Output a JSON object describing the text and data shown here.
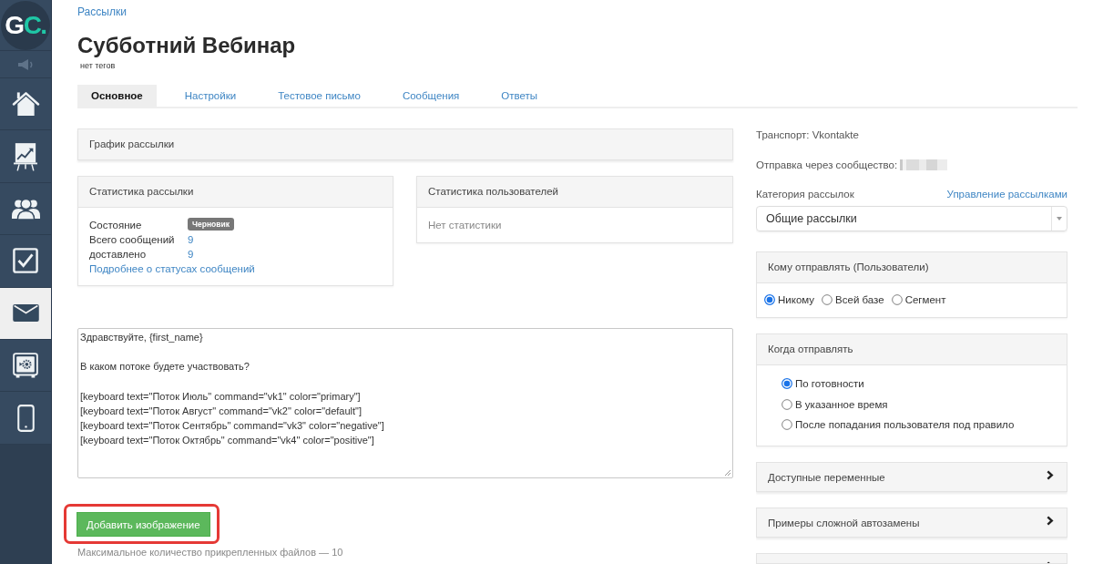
{
  "sidebar": {
    "logo": "GC.",
    "items": [
      {
        "kind": "megaphone",
        "selected": false
      },
      {
        "kind": "home",
        "selected": false
      },
      {
        "kind": "chart",
        "selected": false
      },
      {
        "kind": "users",
        "selected": false
      },
      {
        "kind": "tasks",
        "selected": false
      },
      {
        "kind": "mail",
        "selected": true
      },
      {
        "kind": "safe",
        "selected": false
      },
      {
        "kind": "phone",
        "selected": false
      }
    ]
  },
  "breadcrumb": "Рассылки",
  "title": "Субботний Вебинар",
  "tags": "нет тегов",
  "tabs": [
    {
      "label": "Основное",
      "selected": true
    },
    {
      "label": "Настройки",
      "selected": false
    },
    {
      "label": "Тестовое письмо",
      "selected": false
    },
    {
      "label": "Сообщения",
      "selected": false
    },
    {
      "label": "Ответы",
      "selected": false
    }
  ],
  "schedule_panel": {
    "title": "График рассылки"
  },
  "stats_panel": {
    "title": "Статистика рассылки",
    "rows": [
      {
        "label": "Состояние",
        "value": "Черновик",
        "kind": "badge"
      },
      {
        "label": "Всего сообщений",
        "value": "9",
        "kind": "link"
      },
      {
        "label": "доставлено",
        "value": "9",
        "kind": "link"
      }
    ],
    "link": "Подробнее о статусах сообщений"
  },
  "users_panel": {
    "title": "Статистика пользователей",
    "empty_text": "Нет статистики"
  },
  "message": {
    "value": "Здравствуйте, {first_name}\n\nВ каком потоке будете участвовать?\n\n[keyboard text=\"Поток Июль\" command=\"vk1\" color=\"primary\"]\n[keyboard text=\"Поток Август\" command=\"vk2\" color=\"default\"]\n[keyboard text=\"Поток Сентябрь\" command=\"vk3\" color=\"negative\"]\n[keyboard text=\"Поток Октябрь\" command=\"vk4\" color=\"positive\"]"
  },
  "add_image_button": {
    "label": "Добавить изображение",
    "highlighted": true
  },
  "attachments_note": "Максимальное количество прикрепленных файлов — 10",
  "transport": "Транспорт: Vkontakte",
  "community": {
    "label": "Отправка через сообщество:",
    "value_hidden": true
  },
  "category": {
    "label": "Категория рассылок",
    "manage_link": "Управление рассылками",
    "value": "Общие рассылки"
  },
  "recipients": {
    "title": "Кому отправлять (Пользователи)",
    "options": [
      {
        "label": "Никому",
        "selected": true
      },
      {
        "label": "Всей базе",
        "selected": false
      },
      {
        "label": "Сегмент",
        "selected": false
      }
    ]
  },
  "send_time": {
    "title": "Когда отправлять",
    "options": [
      {
        "label": "По готовности",
        "selected": true
      },
      {
        "label": "В указанное время",
        "selected": false
      },
      {
        "label": "После попадания пользователя под правило",
        "selected": false
      }
    ]
  },
  "accordions": [
    {
      "title": "Доступные переменные",
      "expanded": false
    },
    {
      "title": "Примеры сложной автозамены",
      "expanded": false
    },
    {
      "expanded": false
    }
  ]
}
